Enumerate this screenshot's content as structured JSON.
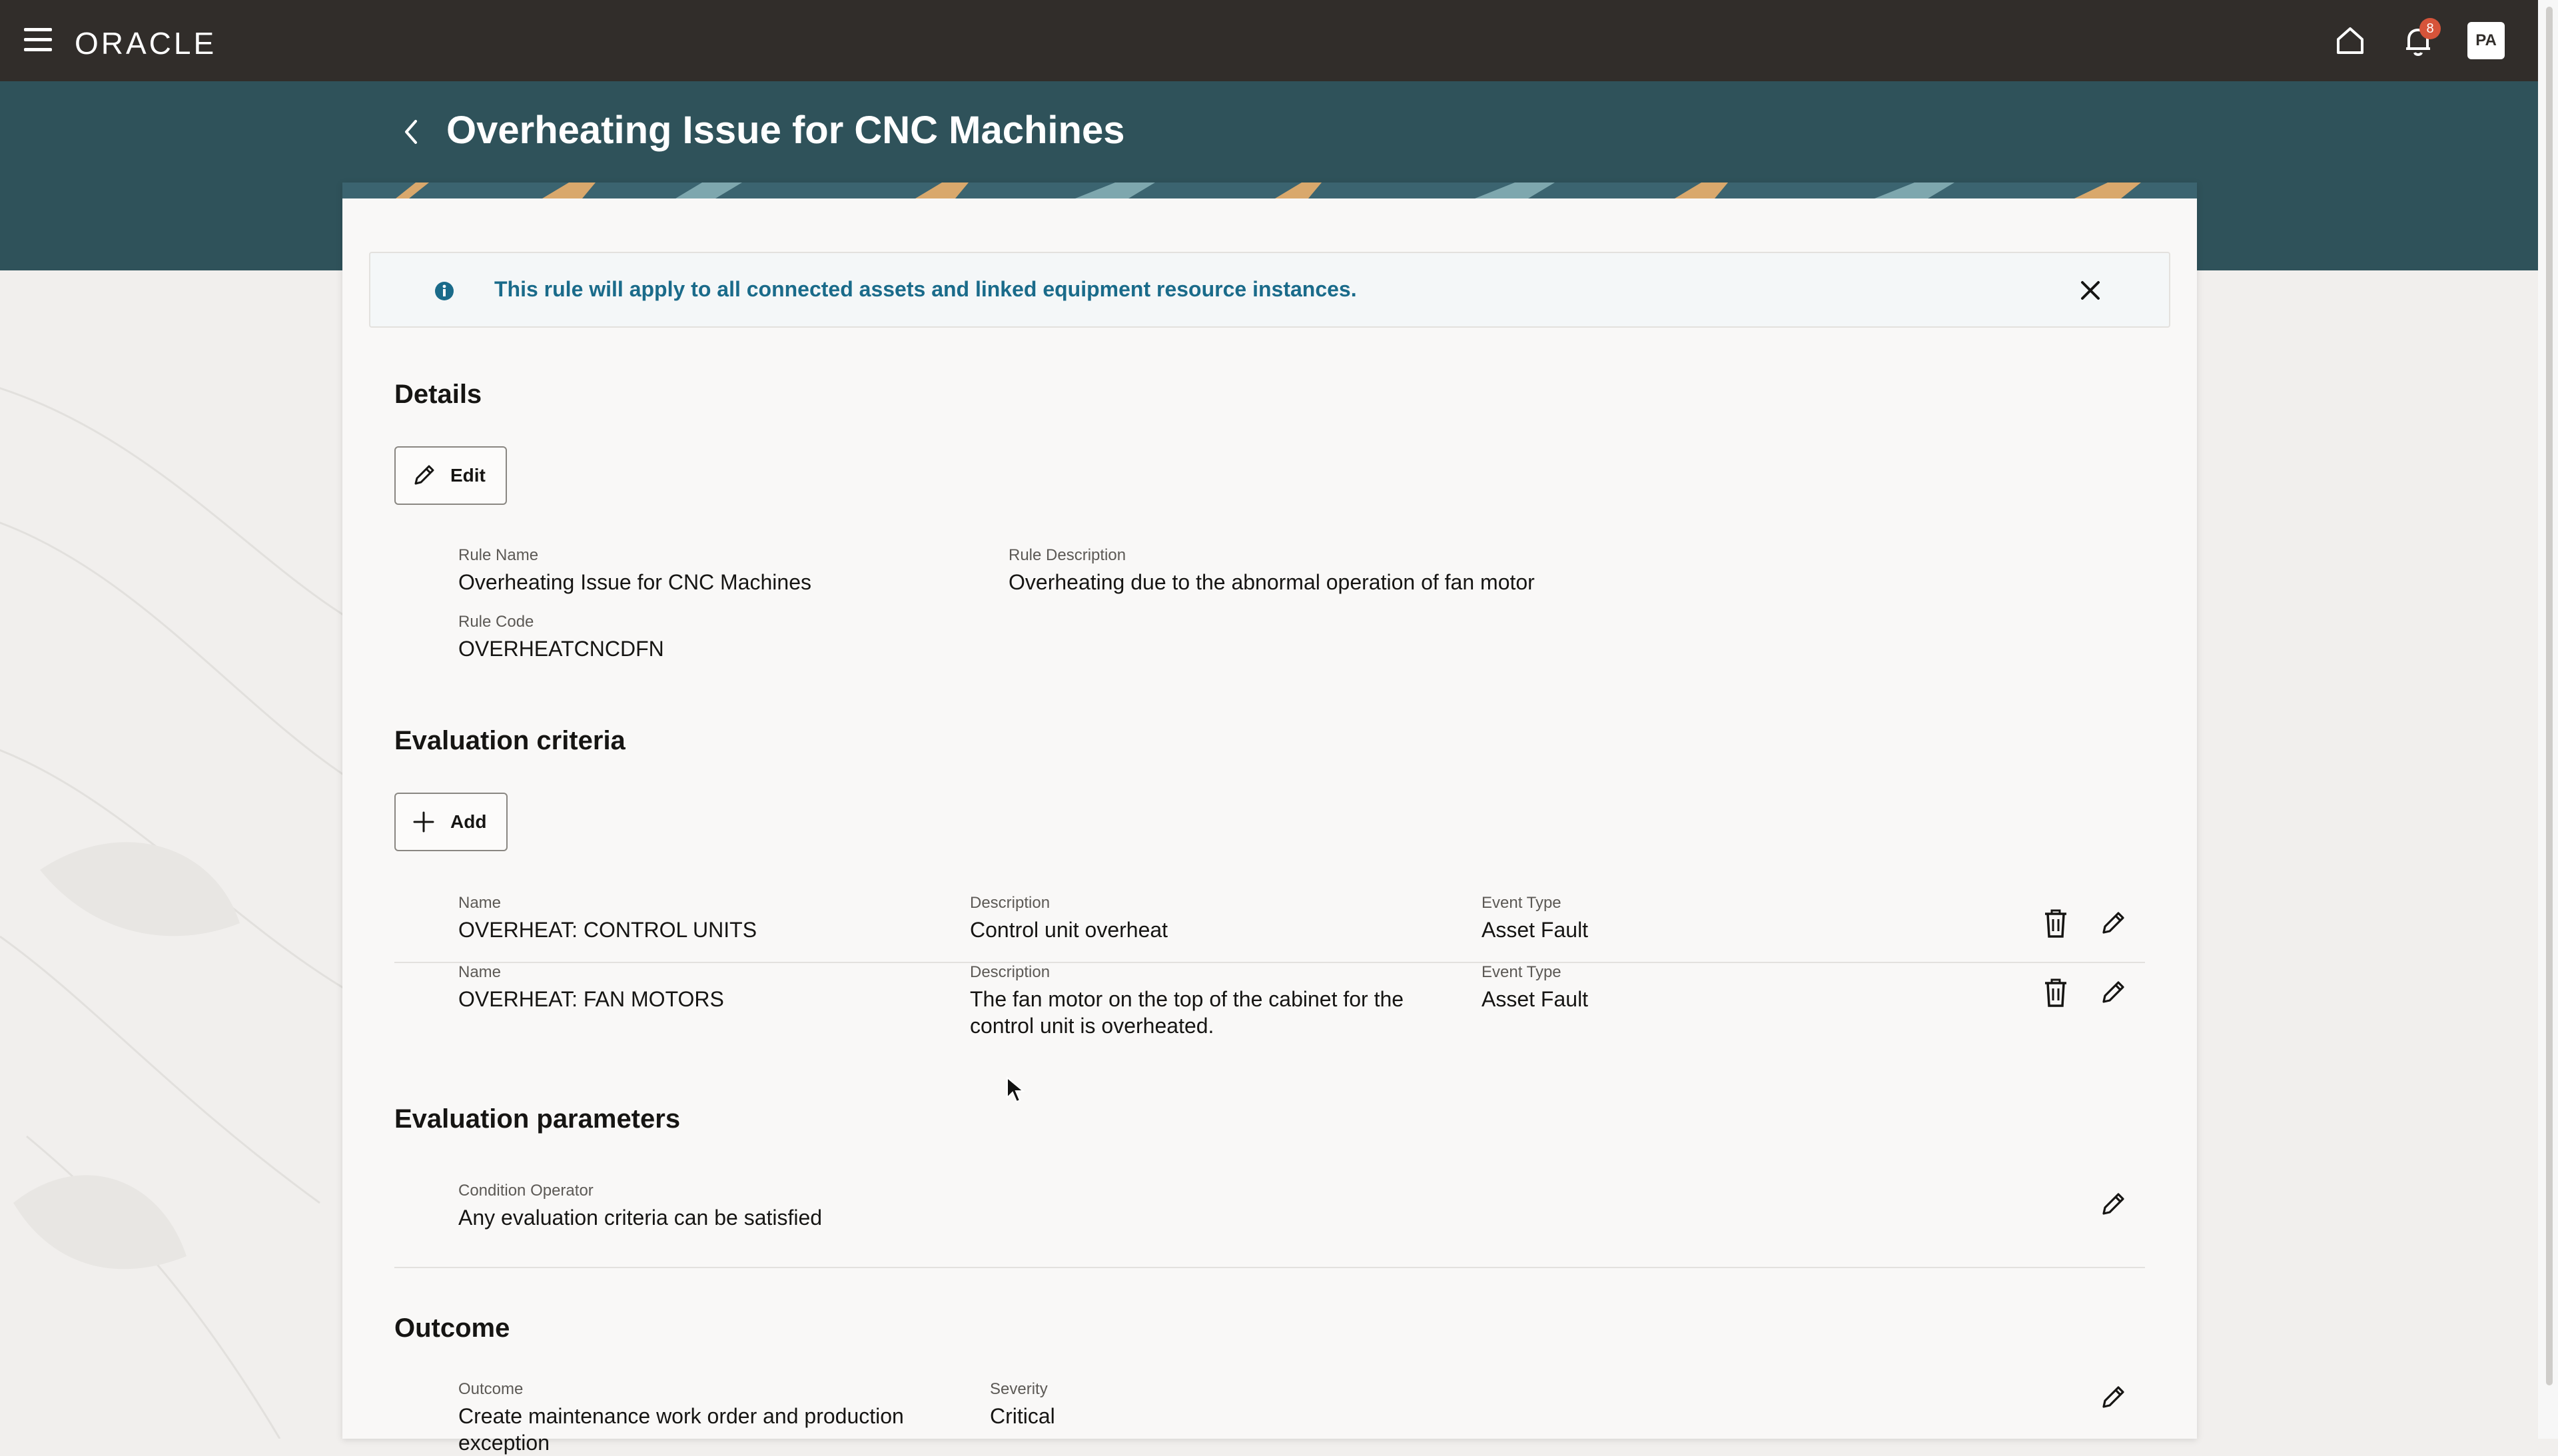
{
  "topbar": {
    "brand": "ORACLE",
    "notification_count": "8",
    "avatar_initials": "PA"
  },
  "header": {
    "title": "Overheating Issue for CNC Machines"
  },
  "banner": {
    "message": "This rule will apply to all connected assets and linked equipment resource instances."
  },
  "details": {
    "title": "Details",
    "edit_label": "Edit",
    "rule_name_label": "Rule Name",
    "rule_name": "Overheating Issue for CNC Machines",
    "rule_description_label": "Rule Description",
    "rule_description": "Overheating due to the abnormal operation of fan motor",
    "rule_code_label": "Rule Code",
    "rule_code": "OVERHEATCNCDFN"
  },
  "criteria": {
    "title": "Evaluation criteria",
    "add_label": "Add",
    "rows": [
      {
        "name_label": "Name",
        "name": "OVERHEAT: CONTROL UNITS",
        "description_label": "Description",
        "description": "Control unit overheat",
        "event_type_label": "Event Type",
        "event_type": "Asset Fault"
      },
      {
        "name_label": "Name",
        "name": "OVERHEAT: FAN MOTORS",
        "description_label": "Description",
        "description": "The fan motor on the top of the cabinet for the control unit is overheated.",
        "event_type_label": "Event Type",
        "event_type": "Asset Fault"
      }
    ]
  },
  "parameters": {
    "title": "Evaluation parameters",
    "condition_operator_label": "Condition Operator",
    "condition_operator": "Any evaluation criteria can be satisfied"
  },
  "outcome": {
    "title": "Outcome",
    "outcome_label": "Outcome",
    "outcome": "Create maintenance work order and production exception",
    "severity_label": "Severity",
    "severity": "Critical"
  },
  "colors": {
    "topbar": "#312d2a",
    "header_band": "#2f525a",
    "info_text": "#1a6b8a",
    "badge": "#d6543a"
  }
}
